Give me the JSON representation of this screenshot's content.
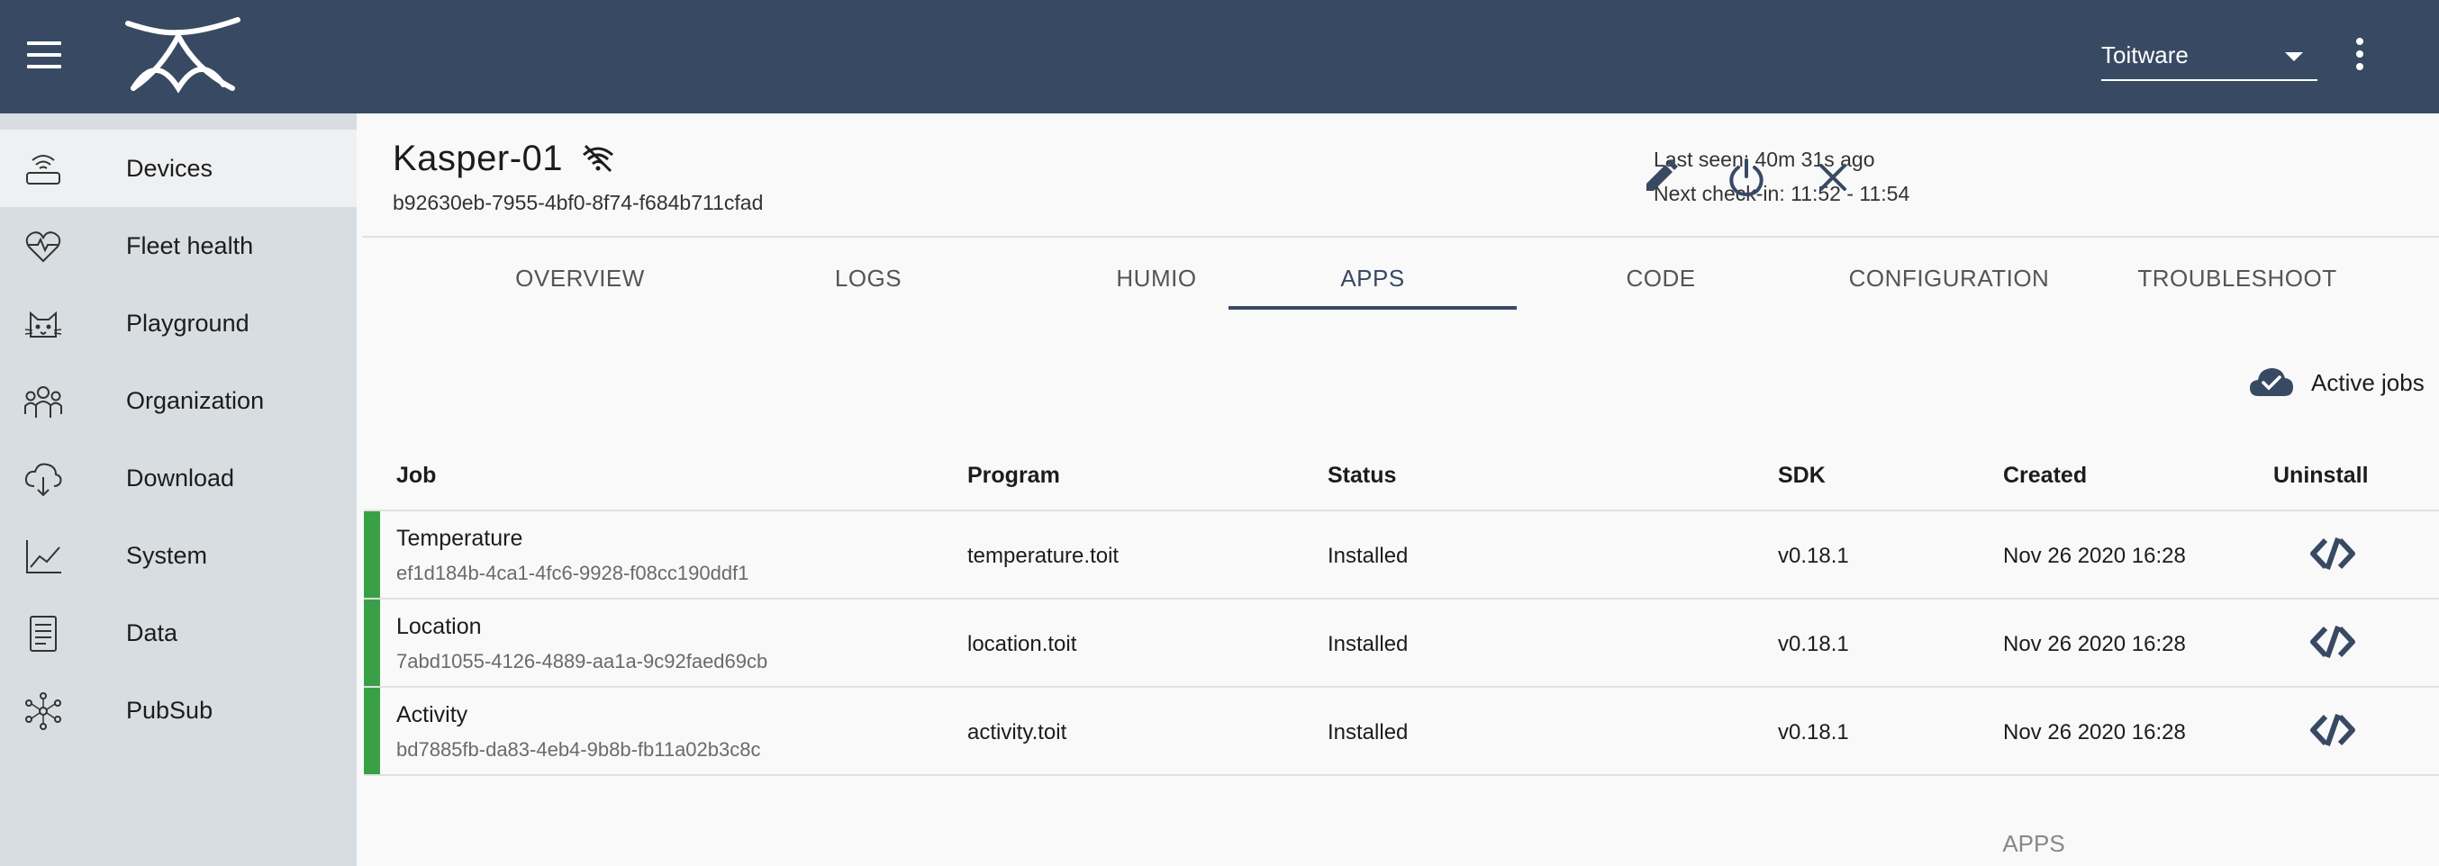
{
  "header": {
    "org_select_value": "Toitware",
    "colors": {
      "topbar": "#384a63",
      "sidebar": "#d8dde1",
      "accent": "#384a63",
      "status_green": "#3aa047"
    }
  },
  "sidebar": {
    "items": [
      {
        "label": "Devices",
        "icon": "devices-icon",
        "active": true
      },
      {
        "label": "Fleet health",
        "icon": "heart-pulse-icon"
      },
      {
        "label": "Playground",
        "icon": "cat-icon"
      },
      {
        "label": "Organization",
        "icon": "people-icon"
      },
      {
        "label": "Download",
        "icon": "cloud-download-icon"
      },
      {
        "label": "System",
        "icon": "line-chart-icon"
      },
      {
        "label": "Data",
        "icon": "document-icon"
      },
      {
        "label": "PubSub",
        "icon": "network-icon"
      }
    ]
  },
  "device": {
    "name": "Kasper-01",
    "id": "b92630eb-7955-4bf0-8f74-f684b711cfad",
    "last_seen": "Last seen: 40m 31s ago",
    "next_checkin": "Next check-in: 11:52 - 11:54"
  },
  "tabs": [
    {
      "label": "OVERVIEW"
    },
    {
      "label": "LOGS"
    },
    {
      "label": "HUMIO"
    },
    {
      "label": "APPS",
      "active": true
    },
    {
      "label": "CODE"
    },
    {
      "label": "CONFIGURATION"
    },
    {
      "label": "TROUBLESHOOT"
    }
  ],
  "active_jobs_label": "Active jobs",
  "table": {
    "headers": [
      "Job",
      "Program",
      "Status",
      "SDK",
      "Created",
      "Uninstall"
    ],
    "rows": [
      {
        "job": "Temperature",
        "id": "ef1d184b-4ca1-4fc6-9928-f08cc190ddf1",
        "program": "temperature.toit",
        "status": "Installed",
        "sdk": "v0.18.1",
        "created": "Nov 26 2020 16:28"
      },
      {
        "job": "Location",
        "id": "7abd1055-4126-4889-aa1a-9c92faed69cb",
        "program": "location.toit",
        "status": "Installed",
        "sdk": "v0.18.1",
        "created": "Nov 26 2020 16:28"
      },
      {
        "job": "Activity",
        "id": "bd7885fb-da83-4eb4-9b8b-fb11a02b3c8c",
        "program": "activity.toit",
        "status": "Installed",
        "sdk": "v0.18.1",
        "created": "Nov 26 2020 16:28"
      }
    ]
  },
  "bottom_tab_label": "APPS"
}
